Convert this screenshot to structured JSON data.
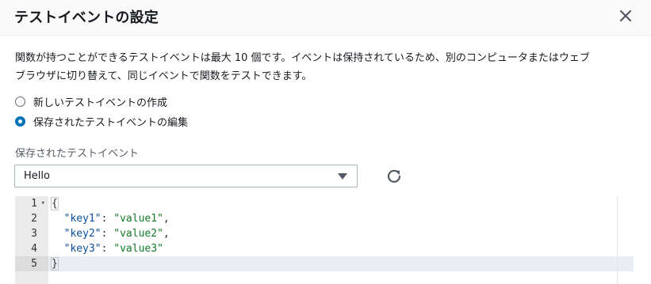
{
  "dialog": {
    "title": "テストイベントの設定",
    "close_icon": "close-icon"
  },
  "description": {
    "line1": "関数が持つことができるテストイベントは最大 10 個です。イベントは保持されているため、別のコンピュータまたはウェブ",
    "line2": "ブラウザに切り替えて、同じイベントで関数をテストできます。"
  },
  "options": [
    {
      "label": "新しいテストイベントの作成",
      "checked": false
    },
    {
      "label": "保存されたテストイベントの編集",
      "checked": true
    }
  ],
  "saved_events": {
    "label": "保存されたテストイベント",
    "selected": "Hello",
    "refresh_icon": "refresh-icon"
  },
  "editor": {
    "line_numbers": [
      "1",
      "2",
      "3",
      "4",
      "5"
    ],
    "active_line": 5,
    "colors": {
      "key": "#0b4e9e",
      "string": "#137a2a"
    },
    "lines": {
      "l1": {
        "brace": "{"
      },
      "l2": {
        "key": "\"key1\"",
        "sep": ": ",
        "value": "\"value1\"",
        "end": ","
      },
      "l3": {
        "key": "\"key2\"",
        "sep": ": ",
        "value": "\"value2\"",
        "end": ","
      },
      "l4": {
        "key": "\"key3\"",
        "sep": ": ",
        "value": "\"value3\"",
        "end": ""
      },
      "l5": {
        "brace": "}"
      }
    }
  }
}
